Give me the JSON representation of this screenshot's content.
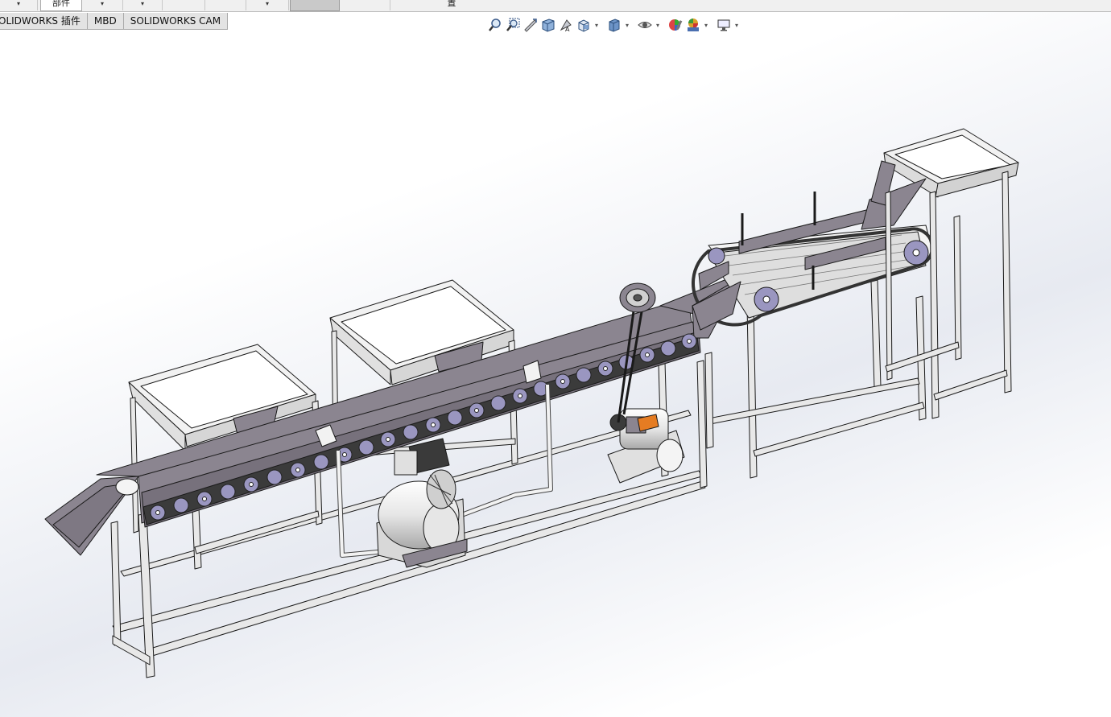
{
  "command_bar": {
    "tab_label": "部件",
    "glyph_label": "置"
  },
  "tabs": [
    {
      "label": "OLIDWORKS 插件"
    },
    {
      "label": "MBD"
    },
    {
      "label": "SOLIDWORKS CAM"
    }
  ],
  "hud": {
    "icons": [
      "zoom-to-fit-icon",
      "zoom-to-area-icon",
      "previous-view-icon",
      "section-view-icon",
      "dynamic-annotation-icon",
      "view-orientation-icon",
      "display-style-icon",
      "hide-show-items-icon",
      "edit-appearance-icon",
      "apply-scene-icon",
      "view-settings-icon"
    ]
  },
  "model": {
    "name": "conveyor-assembly",
    "fill_color": "#8b8590",
    "wheel_color": "#9a96c0",
    "frame_color": "#e8e8e8",
    "edge_color": "#1a1a1a"
  }
}
